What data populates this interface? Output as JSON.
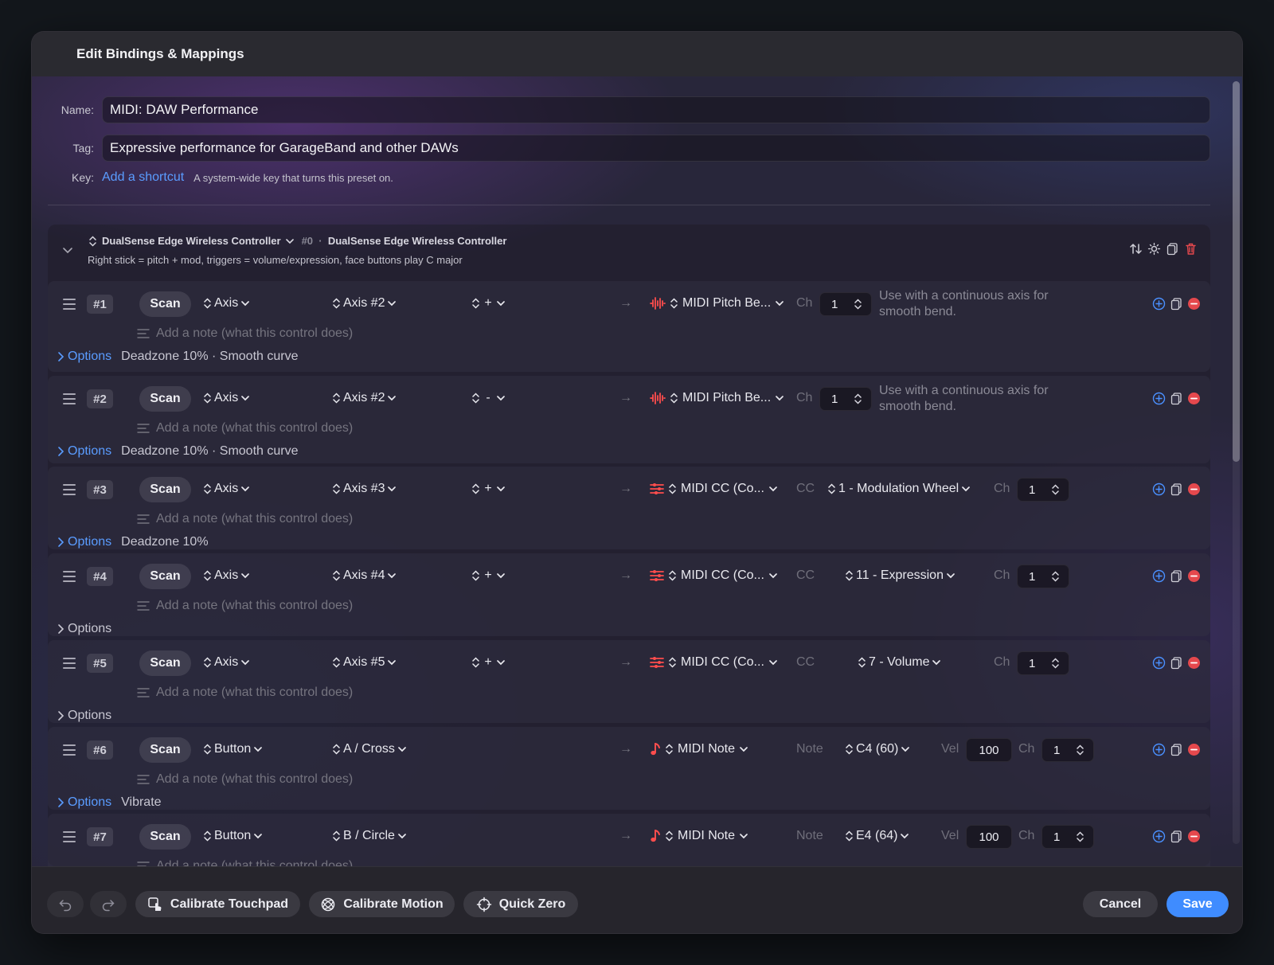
{
  "title": "Edit Bindings & Mappings",
  "form": {
    "name_label": "Name:",
    "name_value": "MIDI: DAW Performance",
    "tag_label": "Tag:",
    "tag_value": "Expressive performance for GarageBand and other DAWs",
    "key_label": "Key:",
    "key_link": "Add a shortcut",
    "key_desc": "A system-wide key that turns this preset on."
  },
  "device": {
    "name": "DualSense Edge Wireless Controller",
    "index": "#0",
    "separator": "·",
    "full_name": "DualSense Edge Wireless Controller",
    "description": "Right stick = pitch + mod, triggers = volume/expression, face buttons play C major"
  },
  "labels": {
    "scan": "Scan",
    "note_placeholder": "Add a note (what this control does)",
    "options": "Options",
    "ch": "Ch",
    "cc": "CC",
    "note": "Note",
    "vel": "Vel",
    "arrow": "→"
  },
  "rows": [
    {
      "num": "#1",
      "kind": "Axis",
      "input": "Axis #2",
      "dir": "+",
      "target": "MIDI Pitch Be...",
      "target_icon": "waveform-icon",
      "ch": "1",
      "hint": "Use with a continuous axis for smooth bend.",
      "options_summary": "Deadzone 10% · Smooth curve"
    },
    {
      "num": "#2",
      "kind": "Axis",
      "input": "Axis #2",
      "dir": "-",
      "target": "MIDI Pitch Be...",
      "target_icon": "waveform-icon",
      "ch": "1",
      "hint": "Use with a continuous axis for smooth bend.",
      "options_summary": "Deadzone 10% · Smooth curve"
    },
    {
      "num": "#3",
      "kind": "Axis",
      "input": "Axis #3",
      "dir": "+",
      "target": "MIDI CC (Co...",
      "target_icon": "sliders-icon",
      "cc": "1 - Modulation Wheel",
      "ch": "1",
      "options_summary": "Deadzone 10%"
    },
    {
      "num": "#4",
      "kind": "Axis",
      "input": "Axis #4",
      "dir": "+",
      "target": "MIDI CC (Co...",
      "target_icon": "sliders-icon",
      "cc": "11 - Expression",
      "ch": "1",
      "options_summary": ""
    },
    {
      "num": "#5",
      "kind": "Axis",
      "input": "Axis #5",
      "dir": "+",
      "target": "MIDI CC (Co...",
      "target_icon": "sliders-icon",
      "cc": "7 - Volume",
      "ch": "1",
      "options_summary": ""
    },
    {
      "num": "#6",
      "kind": "Button",
      "input": "A / Cross",
      "target": "MIDI Note",
      "target_icon": "music-note-icon",
      "note": "C4 (60)",
      "vel": "100",
      "ch": "1",
      "options_summary": "Vibrate"
    },
    {
      "num": "#7",
      "kind": "Button",
      "input": "B / Circle",
      "target": "MIDI Note",
      "target_icon": "music-note-icon",
      "note": "E4 (64)",
      "vel": "100",
      "ch": "1",
      "options_summary": ""
    }
  ],
  "footer": {
    "calibrate_touchpad": "Calibrate Touchpad",
    "calibrate_motion": "Calibrate Motion",
    "quick_zero": "Quick Zero",
    "cancel": "Cancel",
    "save": "Save"
  },
  "colors": {
    "accent": "#3f8cff",
    "link": "#5a9cff",
    "target_icon": "#ff4d4d",
    "remove": "#e5484d"
  }
}
